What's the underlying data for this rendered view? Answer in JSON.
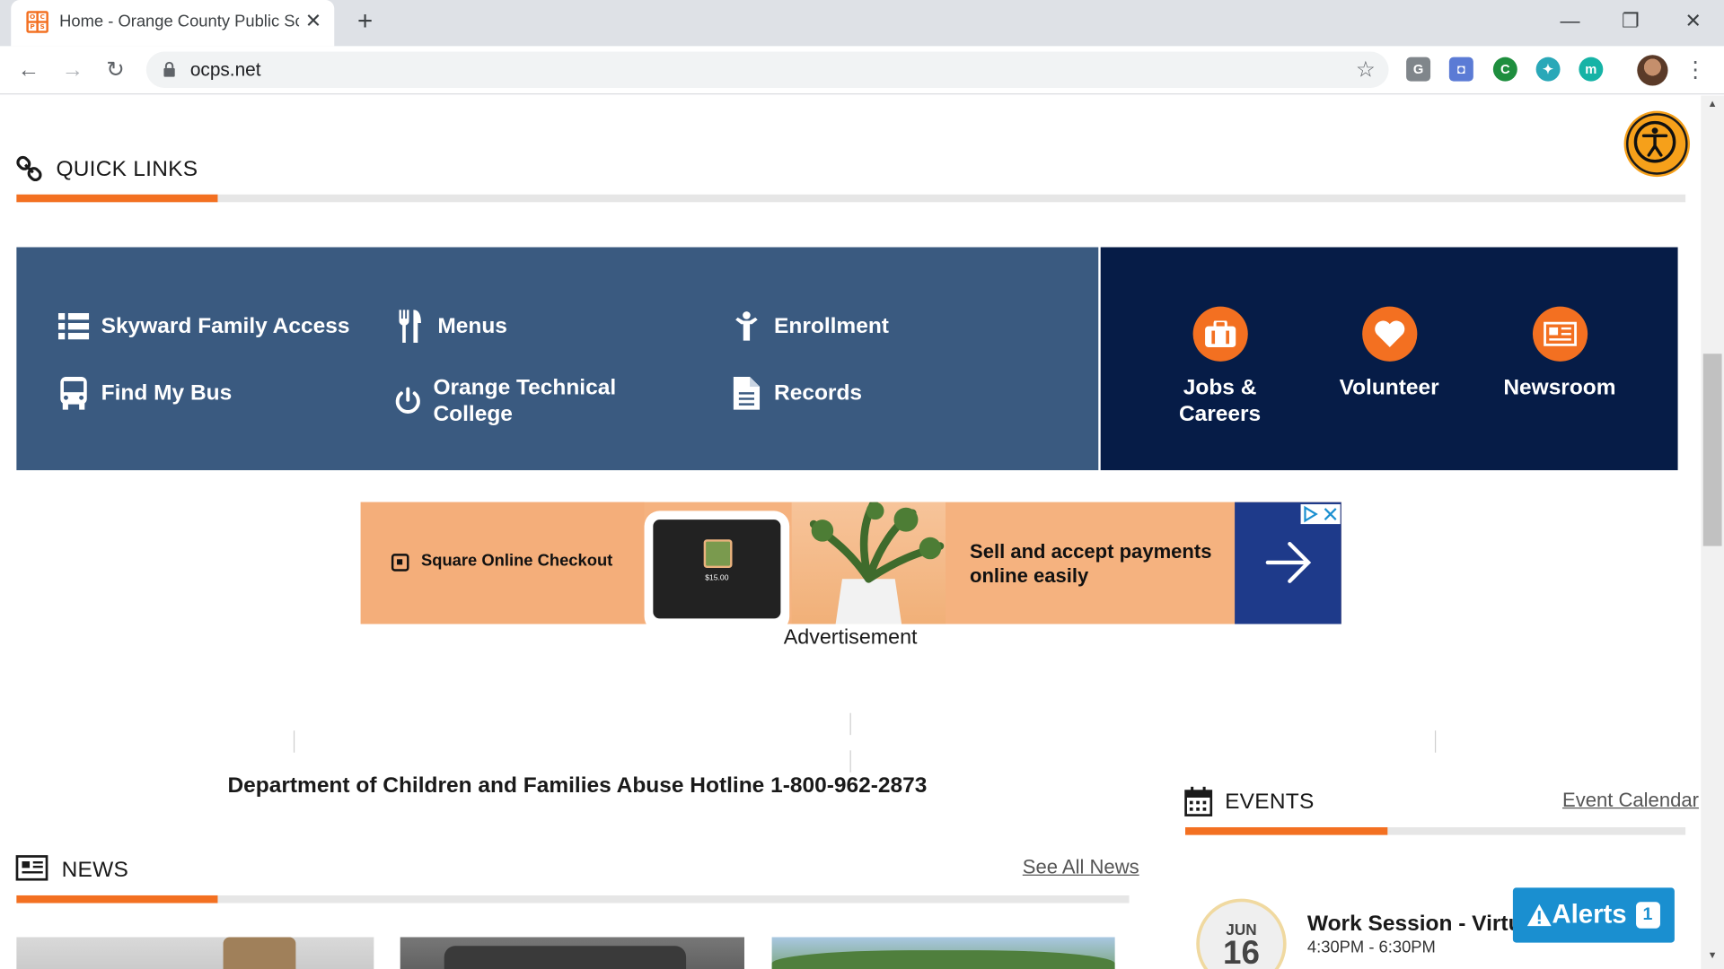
{
  "browser": {
    "tab_title": "Home - Orange County Public Sc",
    "favicon_letters": [
      "O",
      "C",
      "P",
      "S"
    ],
    "url": "ocps.net",
    "nav": {
      "back": "←",
      "forward": "→",
      "reload": "↻"
    },
    "window": {
      "minimize": "—",
      "restore": "❐",
      "close": "✕"
    },
    "new_tab": "+",
    "tab_close": "✕",
    "star": "☆",
    "menu": "⋮",
    "extensions": [
      {
        "name": "g-extension-icon",
        "label": "G",
        "color": "#80868b"
      },
      {
        "name": "camera-extension-icon",
        "label": "◘",
        "color": "#5b7bd5"
      },
      {
        "name": "green-extension-icon",
        "label": "C",
        "color": "#1e8e3e"
      },
      {
        "name": "bird-extension-icon",
        "label": "✦",
        "color": "#2aa8b8"
      },
      {
        "name": "m-extension-icon",
        "label": "m",
        "color": "#16b3a6"
      }
    ]
  },
  "quick_links": {
    "title": "QUICK LINKS",
    "items": [
      {
        "label": "Skyward Family Access",
        "icon": "list-icon"
      },
      {
        "label": "Menus",
        "icon": "utensils-icon"
      },
      {
        "label": "Enrollment",
        "icon": "child-icon"
      },
      {
        "label": "Find My Bus",
        "icon": "bus-icon"
      },
      {
        "label": "Orange Technical College",
        "icon": "power-icon"
      },
      {
        "label": "Records",
        "icon": "document-icon"
      }
    ],
    "featured": [
      {
        "label": "Jobs & Careers",
        "icon": "briefcase-icon"
      },
      {
        "label": "Volunteer",
        "icon": "heart-icon"
      },
      {
        "label": "Newsroom",
        "icon": "newspaper-icon"
      }
    ]
  },
  "ad": {
    "brand": "Square Online Checkout",
    "headline": "Sell and accept payments online easily",
    "price": "$15.00",
    "caption": "Advertisement"
  },
  "hotline": "Department of Children and Families Abuse Hotline 1-800-962-2873",
  "news": {
    "title": "NEWS",
    "link": "See All News"
  },
  "events": {
    "title": "EVENTS",
    "link": "Event Calendar",
    "items": [
      {
        "month": "JUN",
        "day": "16",
        "title": "Work Session - Virtua",
        "time": "4:30PM - 6:30PM"
      }
    ]
  },
  "alerts": {
    "label": "Alerts",
    "count": "1"
  }
}
